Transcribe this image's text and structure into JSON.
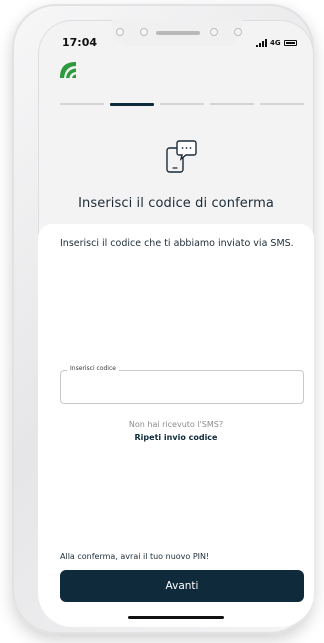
{
  "status_bar": {
    "time": "17:04",
    "network": "4G"
  },
  "icons": {
    "logo": "leaf-logo-icon",
    "sms": "sms-chat-icon"
  },
  "colors": {
    "primary": "#0e2a3b",
    "logo_green": "#2e9a3e",
    "background": "#f3f3f4",
    "card": "#ffffff"
  },
  "progress": {
    "total_steps": 5,
    "current_step": 2
  },
  "header": {
    "title": "Inserisci il codice di conferma"
  },
  "form": {
    "instruction": "Inserisci il codice che ti abbiamo inviato via SMS.",
    "code_label": "Inserisci codice",
    "code_value": "",
    "not_received": "Non hai ricevuto l'SMS?",
    "resend_link": "Ripeti invio codice",
    "confirm_note": "Alla conferma, avrai il tuo nuovo PIN!",
    "submit_label": "Avanti"
  }
}
